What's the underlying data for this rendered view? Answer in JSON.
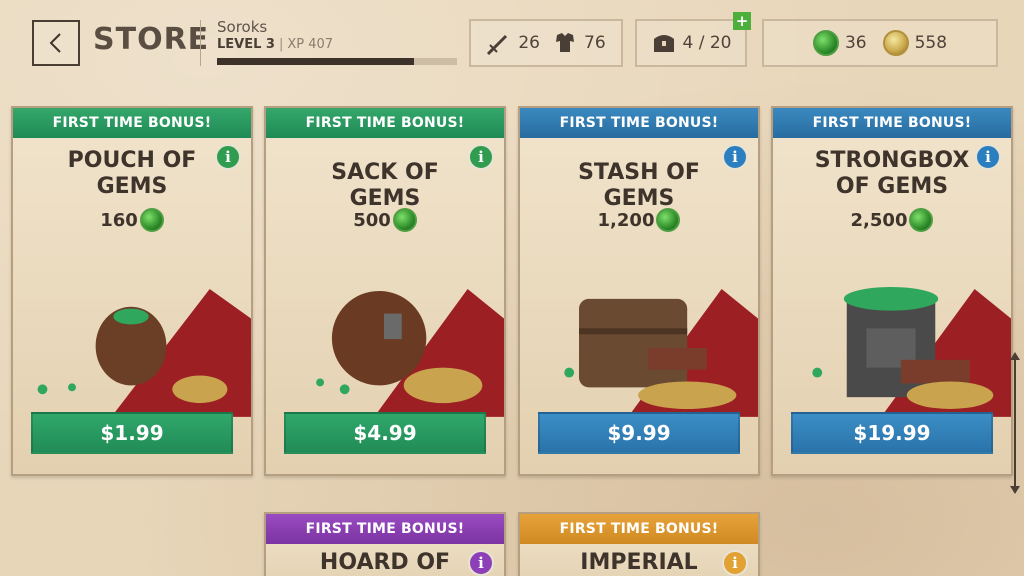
{
  "header": {
    "title": "STORE",
    "player_name": "Soroks",
    "level": "LEVEL 3",
    "xp": "XP 407",
    "xp_progress": 0.82
  },
  "stats": {
    "attack": "26",
    "defense": "76",
    "inventory": "4 / 20",
    "gems": "36",
    "gold": "558"
  },
  "cards": [
    {
      "bonus": "FIRST TIME BONUS!",
      "name": "POUCH OF GEMS",
      "amount": "160",
      "price": "$1.99",
      "color": "green"
    },
    {
      "bonus": "FIRST TIME BONUS!",
      "name": "SACK OF GEMS",
      "amount": "500",
      "price": "$4.99",
      "color": "green"
    },
    {
      "bonus": "FIRST TIME BONUS!",
      "name": "STASH OF GEMS",
      "amount": "1,200",
      "price": "$9.99",
      "color": "blue"
    },
    {
      "bonus": "FIRST TIME BONUS!",
      "name": "STRONGBOX OF GEMS",
      "amount": "2,500",
      "price": "$19.99",
      "color": "blue"
    },
    {
      "bonus": "FIRST TIME BONUS!",
      "name": "HOARD OF",
      "color": "purple"
    },
    {
      "bonus": "FIRST TIME BONUS!",
      "name": "IMPERIAL",
      "color": "orange"
    }
  ],
  "icons": {
    "back": "chevron-left-icon",
    "attack": "sword-icon",
    "defense": "armor-icon",
    "inventory": "chest-icon",
    "add": "plus-icon",
    "gem": "gem-icon",
    "gold": "coin-icon",
    "info": "info-icon"
  },
  "info_label": "i",
  "plus_label": "+"
}
